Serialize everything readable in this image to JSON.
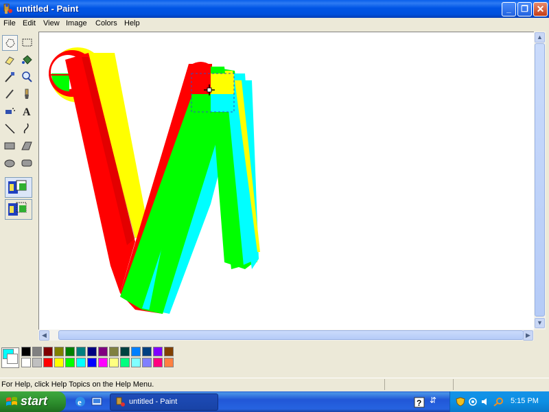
{
  "window": {
    "title": "untitled - Paint"
  },
  "menu": {
    "items": [
      "File",
      "Edit",
      "View",
      "Image",
      "Colors",
      "Help"
    ]
  },
  "tools": [
    "free-form-select-icon",
    "select-icon",
    "eraser-icon",
    "fill-with-color-icon",
    "pick-color-icon",
    "magnifier-icon",
    "pencil-icon",
    "brush-icon",
    "airbrush-icon",
    "text-icon",
    "line-icon",
    "curve-icon",
    "rectangle-icon",
    "polygon-icon",
    "ellipse-icon",
    "rounded-rectangle-icon"
  ],
  "selected_tool": "free-form-select-icon",
  "palette": {
    "foreground": "#00FFFF",
    "background": "#FFFFFF",
    "row1": [
      "#000000",
      "#808080",
      "#800000",
      "#808000",
      "#008000",
      "#008080",
      "#000080",
      "#800080",
      "#808040",
      "#004040",
      "#0080FF",
      "#004080",
      "#8000FF",
      "#804000"
    ],
    "row2": [
      "#FFFFFF",
      "#C0C0C0",
      "#FF0000",
      "#FFFF00",
      "#00FF00",
      "#00FFFF",
      "#0000FF",
      "#FF00FF",
      "#FFFF80",
      "#00FF80",
      "#80FFFF",
      "#8080FF",
      "#FF0080",
      "#FF8040"
    ]
  },
  "status": {
    "text": "For Help, click Help Topics on the Help Menu."
  },
  "taskbar": {
    "start_label": "start",
    "task_label": "untitled - Paint",
    "clock": "5:15 PM"
  }
}
